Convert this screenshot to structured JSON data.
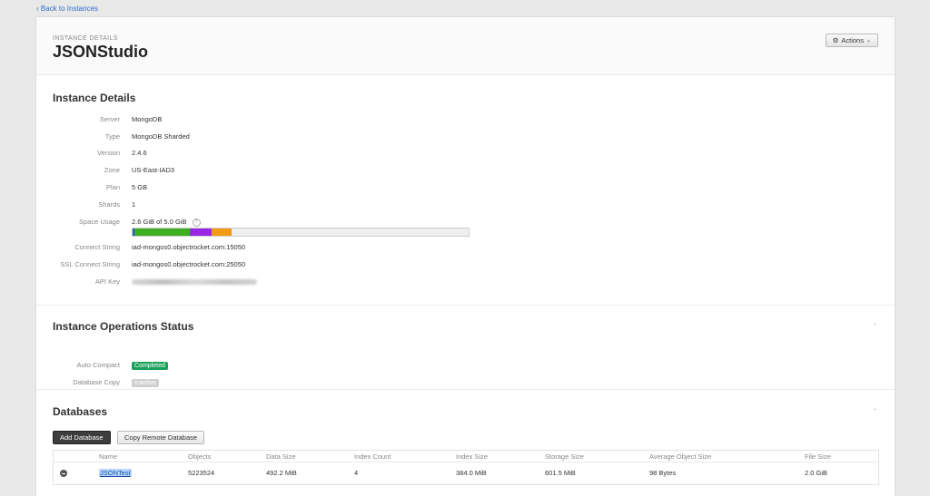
{
  "nav": {
    "back_label": "‹ Back to Instances"
  },
  "header": {
    "eyebrow": "INSTANCE DETAILS",
    "title": "JSONStudio",
    "actions_label": "Actions",
    "actions_icon": "gear-icon"
  },
  "details": {
    "title": "Instance Details",
    "rows": [
      {
        "label": "Server",
        "value": "MongoDB"
      },
      {
        "label": "Type",
        "value": "MongoDB Sharded"
      },
      {
        "label": "Version",
        "value": "2.4.6"
      },
      {
        "label": "Zone",
        "value": "US-East-IAD3"
      },
      {
        "label": "Plan",
        "value": "5 GB"
      },
      {
        "label": "Shards",
        "value": "1"
      }
    ],
    "space_usage": {
      "label": "Space Usage",
      "value": "2.6 GiB of 5.0 GiB",
      "help_glyph": "?",
      "segments": [
        {
          "fraction": 0.006,
          "color": "#1f5fc2"
        },
        {
          "fraction": 0.165,
          "color": "#3fae1f"
        },
        {
          "fraction": 0.065,
          "color": "#9b27e6"
        },
        {
          "fraction": 0.058,
          "color": "#f39a12"
        }
      ]
    },
    "connect": [
      {
        "label": "Connect String",
        "value": "iad-mongos0.objectrocket.com:15050"
      },
      {
        "label": "SSL Connect String",
        "value": "iad-mongos0.objectrocket.com:25050"
      }
    ],
    "api_key_label": "API Key"
  },
  "ops": {
    "title": "Instance Operations Status",
    "rows": [
      {
        "label": "Auto Compact",
        "value": "Completed",
        "color": "#1aa05a"
      },
      {
        "label": "Database Copy",
        "value": "Inactive",
        "color": "#cfcfcf"
      }
    ]
  },
  "databases": {
    "title": "Databases",
    "add_label": "Add Database",
    "copy_label": "Copy Remote Database",
    "columns": [
      "Name",
      "Objects",
      "Data Size",
      "Index Count",
      "Index Size",
      "Storage Size",
      "Average Object Size",
      "File Size"
    ],
    "rows": [
      [
        "JSONTest",
        "5223524",
        "492.2 MiB",
        "4",
        "384.0 MiB",
        "601.5 MiB",
        "98 Bytes",
        "2.0 GiB"
      ]
    ]
  }
}
